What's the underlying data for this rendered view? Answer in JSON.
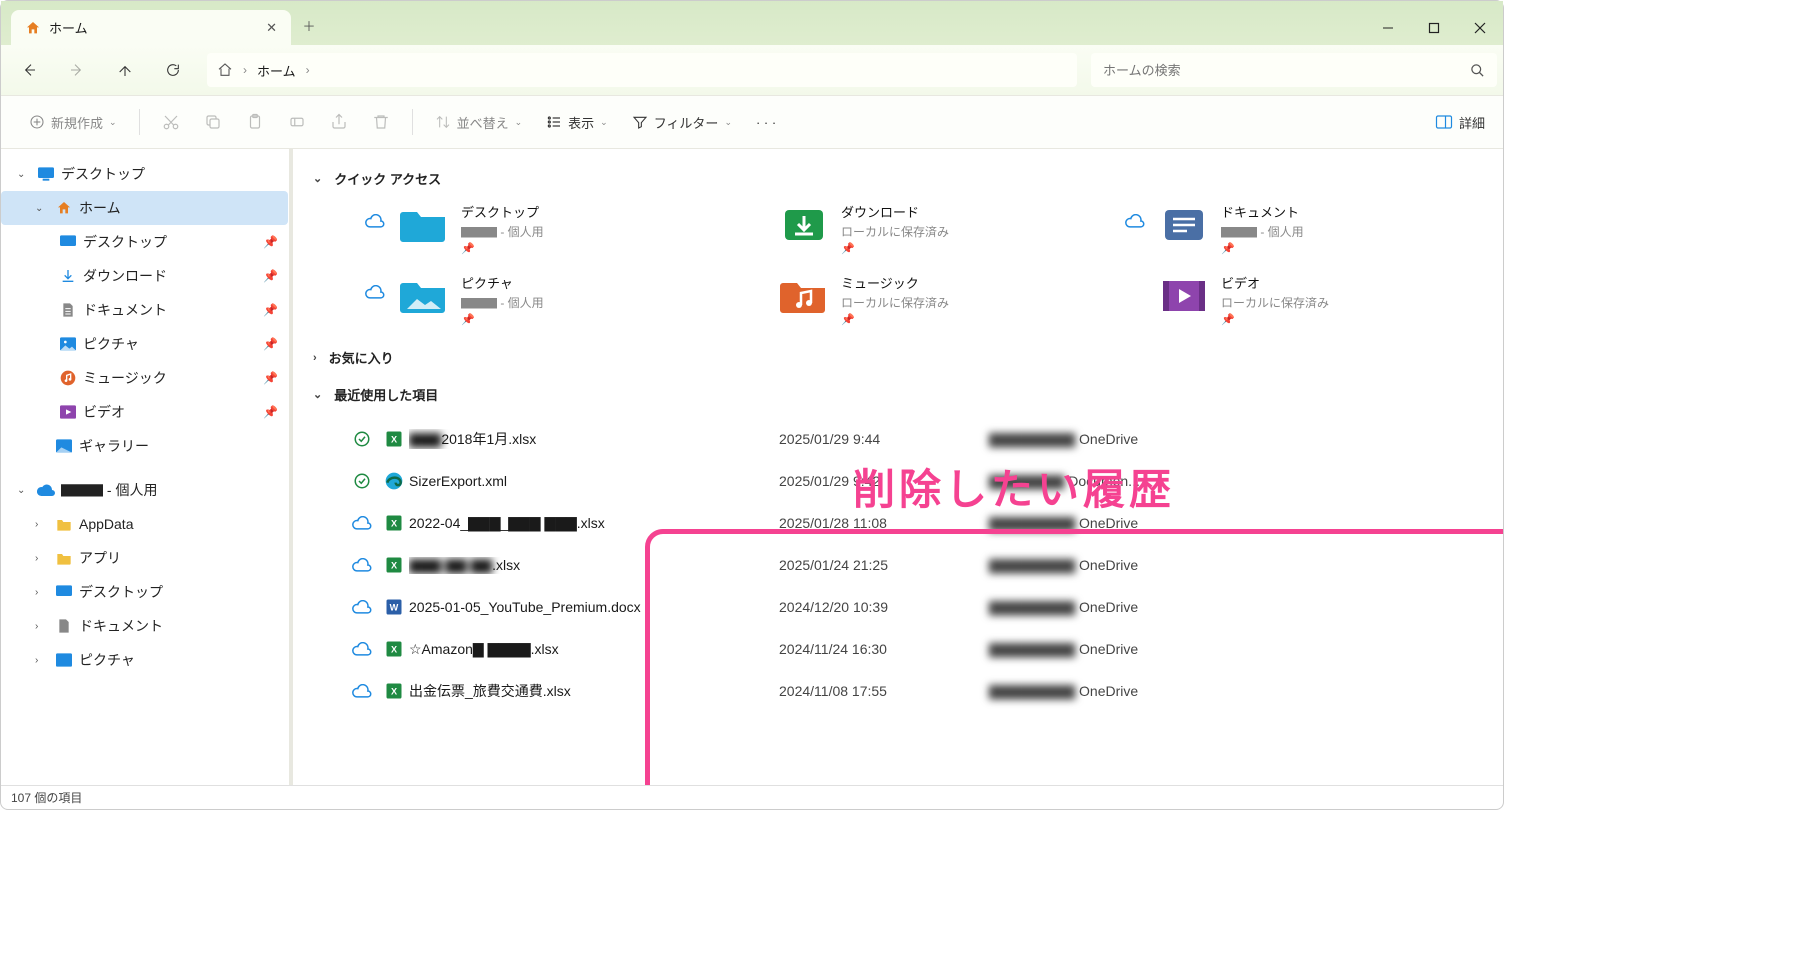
{
  "tab": {
    "title": "ホーム"
  },
  "window": {
    "minimize": "–",
    "maximize": "▢",
    "close": "✕"
  },
  "nav": {
    "back": "←",
    "forward": "→",
    "up": "↑",
    "refresh": "⟳"
  },
  "address": {
    "home_icon": "⌂",
    "segment1": "ホーム"
  },
  "search": {
    "placeholder": "ホームの検索"
  },
  "toolbar": {
    "new": "新規作成",
    "sort": "並べ替え",
    "view": "表示",
    "filter": "フィルター",
    "details": "詳細"
  },
  "sidebar": {
    "desktop_root": "デスクトップ",
    "home": "ホーム",
    "desktop": "デスクトップ",
    "downloads": "ダウンロード",
    "documents": "ドキュメント",
    "pictures": "ピクチャ",
    "music": "ミュージック",
    "videos": "ビデオ",
    "gallery": "ギャラリー",
    "onedrive": "▇▇▇ - 個人用",
    "appdata": "AppData",
    "apps": "アプリ",
    "desktop2": "デスクトップ",
    "documents2": "ドキュメント",
    "pictures2": "ピクチャ"
  },
  "sections": {
    "quick_access": "クイック アクセス",
    "favorites": "お気に入り",
    "recent": "最近使用した項目"
  },
  "quick_access": [
    {
      "name": "デスクトップ",
      "sub": "▇▇▇ - 個人用",
      "cloud": true,
      "folder": "desktop"
    },
    {
      "name": "ダウンロード",
      "sub": "ローカルに保存済み",
      "cloud": false,
      "folder": "download"
    },
    {
      "name": "ドキュメント",
      "sub": "▇▇▇ - 個人用",
      "cloud": true,
      "folder": "document"
    },
    {
      "name": "ピクチャ",
      "sub": "▇▇▇ - 個人用",
      "cloud": true,
      "folder": "picture"
    },
    {
      "name": "ミュージック",
      "sub": "ローカルに保存済み",
      "cloud": false,
      "folder": "music"
    },
    {
      "name": "ビデオ",
      "sub": "ローカルに保存済み",
      "cloud": false,
      "folder": "video"
    }
  ],
  "annotation": "削除したい履歴",
  "recent": [
    {
      "status": "synced",
      "type": "xlsx",
      "name_prefix": "▇▇▇ ",
      "name": "2018年1月.xlsx",
      "date": "2025/01/29 9:44",
      "loc_prefix": "▇▇▇▇▇▇▇▇ ",
      "loc": "OneDrive"
    },
    {
      "status": "synced",
      "type": "edge",
      "name_prefix": "",
      "name": "SizerExport.xml",
      "date": "2025/01/29 9:42",
      "loc_prefix": "▇▇▇▇▇▇▇",
      "loc": "Documen..."
    },
    {
      "status": "cloud",
      "type": "xlsx",
      "name_prefix": "",
      "name": "2022-04_▇▇▇_▇▇▇ ▇▇▇.xlsx",
      "date": "2025/01/28 11:08",
      "loc_prefix": "▇▇▇▇▇▇▇▇ ",
      "loc": "OneDrive"
    },
    {
      "status": "cloud",
      "type": "xlsx",
      "name_prefix": "▇▇▇ ▇▇ ▇▇",
      "name": ".xlsx",
      "date": "2025/01/24 21:25",
      "loc_prefix": "▇▇▇▇▇▇▇▇ ",
      "loc": "OneDrive"
    },
    {
      "status": "cloud",
      "type": "docx",
      "name_prefix": "",
      "name": "2025-01-05_YouTube_Premium.docx",
      "date": "2024/12/20 10:39",
      "loc_prefix": "▇▇▇▇▇▇▇▇ ",
      "loc": "OneDrive"
    },
    {
      "status": "cloud",
      "type": "xlsx",
      "name_prefix": "",
      "name": "☆Amazon▇ ▇▇▇▇.xlsx",
      "date": "2024/11/24 16:30",
      "loc_prefix": "▇▇▇▇▇▇▇▇ ",
      "loc": "OneDrive"
    },
    {
      "status": "cloud",
      "type": "xlsx",
      "name_prefix": "",
      "name": "出金伝票_旅費交通費.xlsx",
      "date": "2024/11/08 17:55",
      "loc_prefix": "▇▇▇▇▇▇▇▇ ",
      "loc": "OneDrive"
    }
  ],
  "statusbar": {
    "text": "107 個の項目"
  }
}
